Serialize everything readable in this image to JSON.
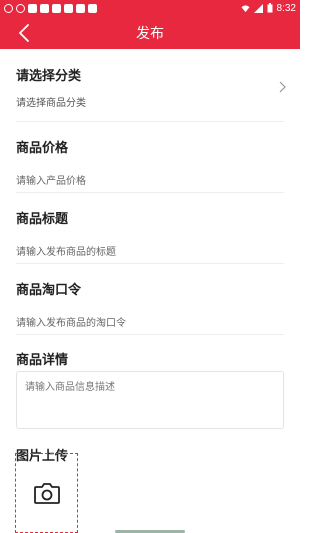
{
  "status_bar": {
    "time": "8:32"
  },
  "nav": {
    "title": "发布"
  },
  "category": {
    "title": "请选择分类",
    "placeholder": "请选择商品分类"
  },
  "price": {
    "title": "商品价格",
    "placeholder": "请输入产品价格"
  },
  "product_title": {
    "title": "商品标题",
    "placeholder": "请输入发布商品的标题"
  },
  "taokouling": {
    "title": "商品淘口令",
    "placeholder": "请输入发布商品的淘口令"
  },
  "details": {
    "title": "商品详情",
    "placeholder": "请输入商品信息描述"
  },
  "image_upload": {
    "title": "图片上传"
  },
  "colors": {
    "accent": "#e8283f",
    "text": "#222222",
    "placeholder": "#666666"
  },
  "icons": [
    "back-arrow-icon",
    "chevron-right-icon",
    "camera-icon"
  ]
}
